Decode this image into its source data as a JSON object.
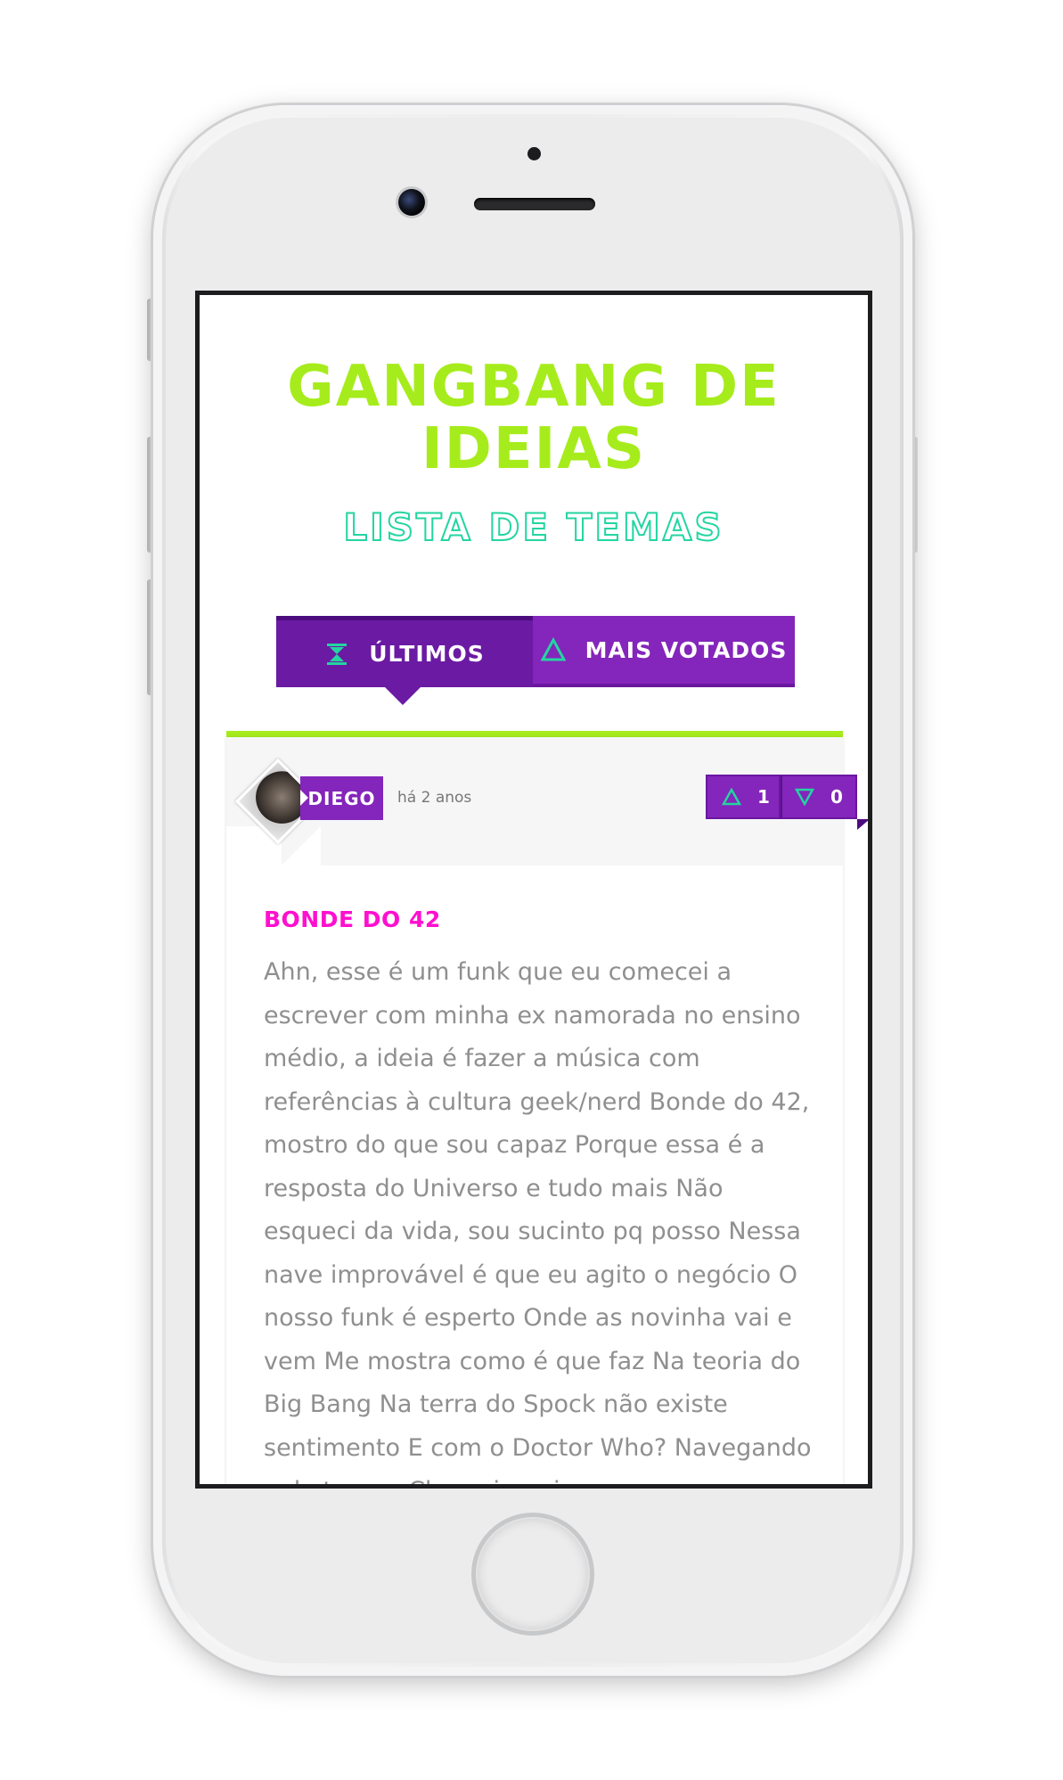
{
  "app": {
    "title_line1": "GANGBANG DE",
    "title_line2": "IDEIAS",
    "subtitle": "LISTA DE TEMAS"
  },
  "tabs": [
    {
      "label": "ÚLTIMOS",
      "icon": "hourglass-icon",
      "active": true
    },
    {
      "label": "MAIS VOTADOS",
      "icon": "triangle-up-icon",
      "active": false
    }
  ],
  "post": {
    "author": "DIEGO",
    "time": "há 2 anos",
    "upvotes": "1",
    "downvotes": "0",
    "title": "BONDE DO 42",
    "body": "Ahn, esse é um funk que eu comecei a escrever com minha ex namorada no ensino médio, a ideia é fazer a música com referências à cultura geek/nerd Bonde do 42, mostro do que sou capaz Porque essa é a resposta do Universo e tudo mais Não esqueci da vida, sou sucinto pq posso Nessa nave improvável é que eu agito o negócio O nosso funk é esperto Onde as novinha vai e vem Me mostra como é que faz Na teoria do Big Bang Na terra do Spock não existe sentimento E com o Doctor Who? Navegando pelo tempo Chamei a mina pra"
  },
  "colors": {
    "title_green": "#a6ec1c",
    "subtitle_teal": "#23d5a1",
    "purple": "#8425bb",
    "purple_dark": "#6b1aa3",
    "post_title_magenta": "#ff0fcf",
    "body_gray": "#8f8f8f"
  }
}
